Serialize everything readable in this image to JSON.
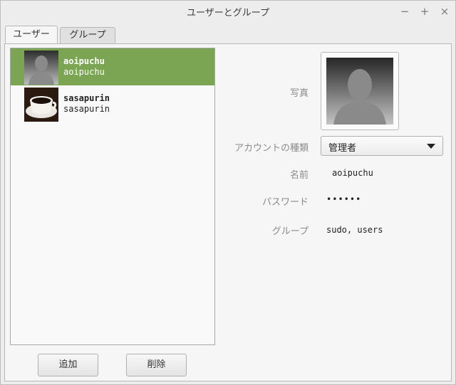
{
  "window": {
    "title": "ユーザーとグループ",
    "minimize": "−",
    "maximize": "+",
    "close": "×"
  },
  "tabs": [
    {
      "label": "ユーザー",
      "active": true
    },
    {
      "label": "グループ",
      "active": false
    }
  ],
  "users": [
    {
      "name": "aoipuchu",
      "login": "aoipuchu",
      "avatar": "silhouette-avatar",
      "selected": true
    },
    {
      "name": "sasapurin",
      "login": "sasapurin",
      "avatar": "coffee-cup-avatar",
      "selected": false
    }
  ],
  "buttons": {
    "add": "追加",
    "delete": "削除"
  },
  "details": {
    "photo_label": "写真",
    "account_type_label": "アカウントの種類",
    "account_type_value": "管理者",
    "name_label": "名前",
    "name_value": "aoipuchu",
    "password_label": "パスワード",
    "password_value": "••••••",
    "groups_label": "グループ",
    "groups_value": "sudo, users"
  },
  "colors": {
    "selection": "#7ba553",
    "window_bg": "#ededed"
  }
}
